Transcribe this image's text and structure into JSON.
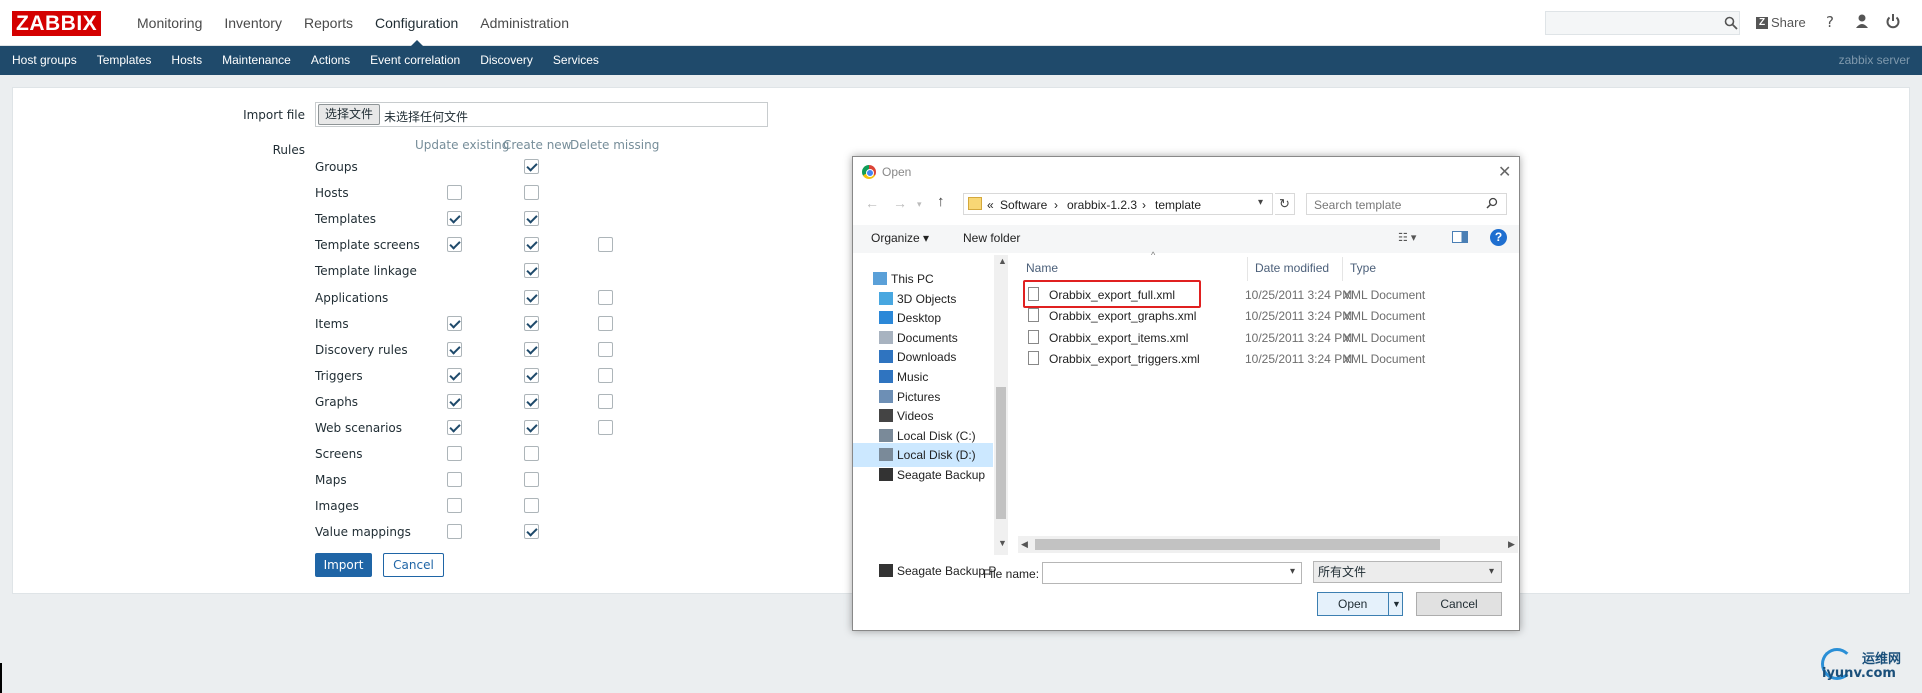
{
  "header": {
    "logo": "ZABBIX",
    "menu": [
      "Monitoring",
      "Inventory",
      "Reports",
      "Configuration",
      "Administration"
    ],
    "active_menu": "Configuration",
    "share_label": "Share",
    "help_label": "?"
  },
  "subnav": {
    "items": [
      "Host groups",
      "Templates",
      "Hosts",
      "Maintenance",
      "Actions",
      "Event correlation",
      "Discovery",
      "Services"
    ],
    "server_name": "zabbix server"
  },
  "form": {
    "import_file_label": "Import file",
    "choose_file_button": "选择文件",
    "no_file_text": "未选择任何文件",
    "rules_label": "Rules",
    "columns": [
      "Update existing",
      "Create new",
      "Delete missing"
    ],
    "rules": [
      {
        "label": "Groups",
        "update": null,
        "create": true,
        "delete": null
      },
      {
        "label": "Hosts",
        "update": false,
        "create": false,
        "delete": null
      },
      {
        "label": "Templates",
        "update": true,
        "create": true,
        "delete": null
      },
      {
        "label": "Template screens",
        "update": true,
        "create": true,
        "delete": false
      },
      {
        "label": "Template linkage",
        "update": null,
        "create": true,
        "delete": null
      },
      {
        "label": "Applications",
        "update": null,
        "create": true,
        "delete": false
      },
      {
        "label": "Items",
        "update": true,
        "create": true,
        "delete": false
      },
      {
        "label": "Discovery rules",
        "update": true,
        "create": true,
        "delete": false
      },
      {
        "label": "Triggers",
        "update": true,
        "create": true,
        "delete": false
      },
      {
        "label": "Graphs",
        "update": true,
        "create": true,
        "delete": false
      },
      {
        "label": "Web scenarios",
        "update": true,
        "create": true,
        "delete": false
      },
      {
        "label": "Screens",
        "update": false,
        "create": false,
        "delete": null
      },
      {
        "label": "Maps",
        "update": false,
        "create": false,
        "delete": null
      },
      {
        "label": "Images",
        "update": false,
        "create": false,
        "delete": null
      },
      {
        "label": "Value mappings",
        "update": false,
        "create": true,
        "delete": null
      }
    ],
    "import_button": "Import",
    "cancel_button": "Cancel"
  },
  "dialog": {
    "title": "Open",
    "breadcrumb": [
      "«",
      "Software",
      "›",
      "orabbix-1.2.3",
      "›",
      "template"
    ],
    "search_placeholder": "Search template",
    "organize_label": "Organize ▾",
    "new_folder_label": "New folder",
    "nav_items": [
      {
        "label": "This PC",
        "icon": "pc-icon"
      },
      {
        "label": "3D Objects",
        "icon": "cube-icon"
      },
      {
        "label": "Desktop",
        "icon": "desktop-icon"
      },
      {
        "label": "Documents",
        "icon": "documents-icon"
      },
      {
        "label": "Downloads",
        "icon": "download-icon"
      },
      {
        "label": "Music",
        "icon": "music-icon"
      },
      {
        "label": "Pictures",
        "icon": "pictures-icon"
      },
      {
        "label": "Videos",
        "icon": "videos-icon"
      },
      {
        "label": "Local Disk (C:)",
        "icon": "disk-icon"
      },
      {
        "label": "Local Disk (D:)",
        "icon": "disk-icon"
      },
      {
        "label": "Seagate Backup",
        "icon": "drive-icon"
      },
      {
        "label": "Seagate Backup P",
        "icon": "drive-icon"
      }
    ],
    "selected_nav": "Local Disk (D:)",
    "columns": [
      "Name",
      "Date modified",
      "Type"
    ],
    "files": [
      {
        "name": "Orabbix_export_full.xml",
        "date": "10/25/2011 3:24 PM",
        "type": "XML Document"
      },
      {
        "name": "Orabbix_export_graphs.xml",
        "date": "10/25/2011 3:24 PM",
        "type": "XML Document"
      },
      {
        "name": "Orabbix_export_items.xml",
        "date": "10/25/2011 3:24 PM",
        "type": "XML Document"
      },
      {
        "name": "Orabbix_export_triggers.xml",
        "date": "10/25/2011 3:24 PM",
        "type": "XML Document"
      }
    ],
    "file_name_label": "File name:",
    "file_name_value": "",
    "file_type_value": "所有文件",
    "open_button": "Open",
    "cancel_button": "Cancel"
  },
  "watermark": {
    "line1": "运维网",
    "line2": "iyunv.com"
  }
}
